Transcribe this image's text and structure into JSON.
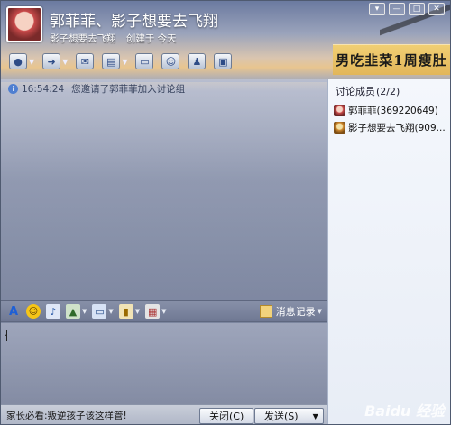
{
  "window": {
    "title": "郭菲菲、影子想要去飞翔",
    "creator": "影子想要去飞翔",
    "created_text": "创建于 今天",
    "controls": [
      "▾",
      "—",
      "□",
      "✕"
    ]
  },
  "toolbar": {
    "items": [
      {
        "name": "video",
        "icon": "●",
        "has_arrow": true
      },
      {
        "name": "file",
        "icon": "➜",
        "has_arrow": true
      },
      {
        "name": "mail",
        "icon": "✉",
        "has_arrow": false
      },
      {
        "name": "app",
        "icon": "▤",
        "has_arrow": true
      },
      {
        "name": "screen",
        "icon": "▭",
        "has_arrow": false
      },
      {
        "name": "invite",
        "icon": "☺",
        "has_arrow": false
      },
      {
        "name": "contact",
        "icon": "♟",
        "has_arrow": false
      },
      {
        "name": "notes",
        "icon": "▣",
        "has_arrow": false
      }
    ]
  },
  "ad_banner": "男吃韭菜1周瘦肚",
  "chat": {
    "system_message": {
      "time": "16:54:24",
      "text": "您邀请了郭菲菲加入讨论组"
    }
  },
  "members": {
    "header_label": "讨论成员",
    "count": "(2/2)",
    "list": [
      {
        "name": "郭菲菲(369220649)"
      },
      {
        "name": "影子想要去飞翔(909..."
      }
    ]
  },
  "format_bar": {
    "history_label": "消息记录"
  },
  "input": {
    "value": "."
  },
  "bottom": {
    "ad_text": "家长必看:叛逆孩子该这样管!",
    "close_label": "关闭(C)",
    "send_label": "发送(S)"
  },
  "watermark": "Baidu 经验"
}
